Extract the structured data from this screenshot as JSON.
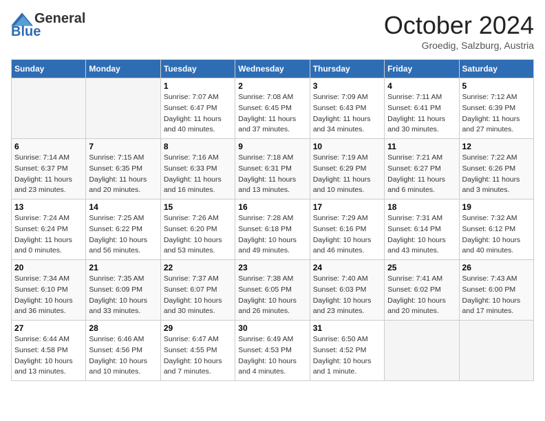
{
  "header": {
    "logo_general": "General",
    "logo_blue": "Blue",
    "month_title": "October 2024",
    "location": "Groedig, Salzburg, Austria"
  },
  "days_of_week": [
    "Sunday",
    "Monday",
    "Tuesday",
    "Wednesday",
    "Thursday",
    "Friday",
    "Saturday"
  ],
  "weeks": [
    [
      {
        "day": "",
        "info": ""
      },
      {
        "day": "",
        "info": ""
      },
      {
        "day": "1",
        "sunrise": "7:07 AM",
        "sunset": "6:47 PM",
        "daylight": "11 hours and 40 minutes."
      },
      {
        "day": "2",
        "sunrise": "7:08 AM",
        "sunset": "6:45 PM",
        "daylight": "11 hours and 37 minutes."
      },
      {
        "day": "3",
        "sunrise": "7:09 AM",
        "sunset": "6:43 PM",
        "daylight": "11 hours and 34 minutes."
      },
      {
        "day": "4",
        "sunrise": "7:11 AM",
        "sunset": "6:41 PM",
        "daylight": "11 hours and 30 minutes."
      },
      {
        "day": "5",
        "sunrise": "7:12 AM",
        "sunset": "6:39 PM",
        "daylight": "11 hours and 27 minutes."
      }
    ],
    [
      {
        "day": "6",
        "sunrise": "7:14 AM",
        "sunset": "6:37 PM",
        "daylight": "11 hours and 23 minutes."
      },
      {
        "day": "7",
        "sunrise": "7:15 AM",
        "sunset": "6:35 PM",
        "daylight": "11 hours and 20 minutes."
      },
      {
        "day": "8",
        "sunrise": "7:16 AM",
        "sunset": "6:33 PM",
        "daylight": "11 hours and 16 minutes."
      },
      {
        "day": "9",
        "sunrise": "7:18 AM",
        "sunset": "6:31 PM",
        "daylight": "11 hours and 13 minutes."
      },
      {
        "day": "10",
        "sunrise": "7:19 AM",
        "sunset": "6:29 PM",
        "daylight": "11 hours and 10 minutes."
      },
      {
        "day": "11",
        "sunrise": "7:21 AM",
        "sunset": "6:27 PM",
        "daylight": "11 hours and 6 minutes."
      },
      {
        "day": "12",
        "sunrise": "7:22 AM",
        "sunset": "6:26 PM",
        "daylight": "11 hours and 3 minutes."
      }
    ],
    [
      {
        "day": "13",
        "sunrise": "7:24 AM",
        "sunset": "6:24 PM",
        "daylight": "11 hours and 0 minutes."
      },
      {
        "day": "14",
        "sunrise": "7:25 AM",
        "sunset": "6:22 PM",
        "daylight": "10 hours and 56 minutes."
      },
      {
        "day": "15",
        "sunrise": "7:26 AM",
        "sunset": "6:20 PM",
        "daylight": "10 hours and 53 minutes."
      },
      {
        "day": "16",
        "sunrise": "7:28 AM",
        "sunset": "6:18 PM",
        "daylight": "10 hours and 49 minutes."
      },
      {
        "day": "17",
        "sunrise": "7:29 AM",
        "sunset": "6:16 PM",
        "daylight": "10 hours and 46 minutes."
      },
      {
        "day": "18",
        "sunrise": "7:31 AM",
        "sunset": "6:14 PM",
        "daylight": "10 hours and 43 minutes."
      },
      {
        "day": "19",
        "sunrise": "7:32 AM",
        "sunset": "6:12 PM",
        "daylight": "10 hours and 40 minutes."
      }
    ],
    [
      {
        "day": "20",
        "sunrise": "7:34 AM",
        "sunset": "6:10 PM",
        "daylight": "10 hours and 36 minutes."
      },
      {
        "day": "21",
        "sunrise": "7:35 AM",
        "sunset": "6:09 PM",
        "daylight": "10 hours and 33 minutes."
      },
      {
        "day": "22",
        "sunrise": "7:37 AM",
        "sunset": "6:07 PM",
        "daylight": "10 hours and 30 minutes."
      },
      {
        "day": "23",
        "sunrise": "7:38 AM",
        "sunset": "6:05 PM",
        "daylight": "10 hours and 26 minutes."
      },
      {
        "day": "24",
        "sunrise": "7:40 AM",
        "sunset": "6:03 PM",
        "daylight": "10 hours and 23 minutes."
      },
      {
        "day": "25",
        "sunrise": "7:41 AM",
        "sunset": "6:02 PM",
        "daylight": "10 hours and 20 minutes."
      },
      {
        "day": "26",
        "sunrise": "7:43 AM",
        "sunset": "6:00 PM",
        "daylight": "10 hours and 17 minutes."
      }
    ],
    [
      {
        "day": "27",
        "sunrise": "6:44 AM",
        "sunset": "4:58 PM",
        "daylight": "10 hours and 13 minutes."
      },
      {
        "day": "28",
        "sunrise": "6:46 AM",
        "sunset": "4:56 PM",
        "daylight": "10 hours and 10 minutes."
      },
      {
        "day": "29",
        "sunrise": "6:47 AM",
        "sunset": "4:55 PM",
        "daylight": "10 hours and 7 minutes."
      },
      {
        "day": "30",
        "sunrise": "6:49 AM",
        "sunset": "4:53 PM",
        "daylight": "10 hours and 4 minutes."
      },
      {
        "day": "31",
        "sunrise": "6:50 AM",
        "sunset": "4:52 PM",
        "daylight": "10 hours and 1 minute."
      },
      {
        "day": "",
        "info": ""
      },
      {
        "day": "",
        "info": ""
      }
    ]
  ]
}
